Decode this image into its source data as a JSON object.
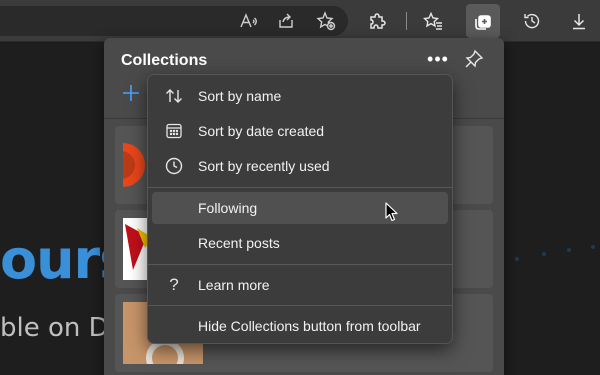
{
  "browser": {
    "toolbar_icons": [
      {
        "name": "read-aloud-icon"
      },
      {
        "name": "share-icon"
      },
      {
        "name": "add-favorite-icon"
      },
      {
        "name": "extensions-icon"
      },
      {
        "name": "favorites-icon"
      },
      {
        "name": "collections-icon",
        "active": true
      },
      {
        "name": "history-icon"
      },
      {
        "name": "downloads-icon"
      }
    ]
  },
  "page": {
    "hero_text": "ours",
    "hero_sub": "ble on D"
  },
  "collections": {
    "title": "Collections",
    "more_icon": "more-icon",
    "pin_icon": "pin-icon",
    "add_icon": "add-icon"
  },
  "menu": {
    "items": [
      {
        "label": "Sort by name",
        "icon": "sort-icon"
      },
      {
        "label": "Sort by date created",
        "icon": "calendar-icon"
      },
      {
        "label": "Sort by recently used",
        "icon": "clock-icon"
      },
      {
        "label": "Following",
        "icon": "",
        "hovered": true
      },
      {
        "label": "Recent posts",
        "icon": ""
      },
      {
        "label": "Learn more",
        "icon": "help-icon"
      },
      {
        "label": "Hide Collections button from toolbar",
        "icon": ""
      }
    ]
  },
  "colors": {
    "toolbar": "#3b3b3b",
    "panel": "#4a4a4a",
    "menu": "#3c3c3c",
    "hero_blue": "#3a8fd9"
  }
}
